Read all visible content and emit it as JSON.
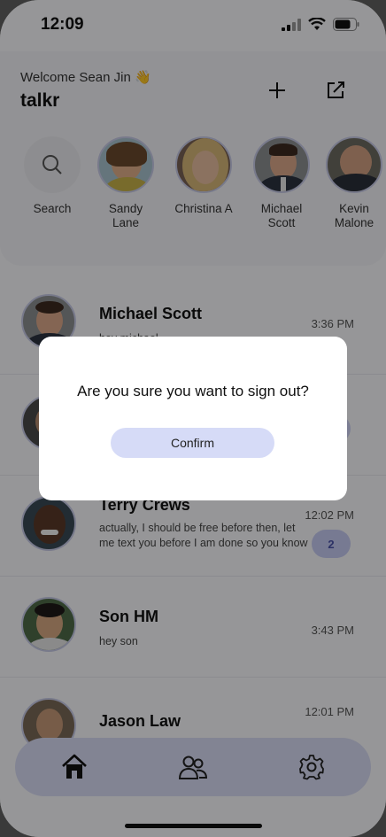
{
  "status_bar": {
    "time": "12:09"
  },
  "header": {
    "welcome": "Welcome Sean Jin 👋",
    "app_title": "talkr"
  },
  "stories": [
    {
      "name": "Search",
      "icon": "search-icon"
    },
    {
      "name": "Sandy\nLane"
    },
    {
      "name": "Christina A"
    },
    {
      "name": "Michael\nScott"
    },
    {
      "name": "Kevin\nMalone"
    }
  ],
  "chats": [
    {
      "name": "Michael Scott",
      "message": "hey michael",
      "time": "3:36 PM"
    },
    {
      "name": "",
      "message": "",
      "time": "",
      "unread": ""
    },
    {
      "name": "Terry Crews",
      "message": "actually, I should be free before then, let me text you before I am done so you know",
      "time": "12:02 PM",
      "unread": "2"
    },
    {
      "name": "Son HM",
      "message": "hey son",
      "time": "3:43 PM"
    },
    {
      "name": "Jason Law",
      "message": "",
      "time": "12:01 PM"
    }
  ],
  "tab_bar": {
    "items": [
      {
        "icon": "home-icon"
      },
      {
        "icon": "people-icon"
      },
      {
        "icon": "gear-icon"
      }
    ]
  },
  "modal": {
    "message": "Are you sure you want to sign out?",
    "confirm_label": "Confirm"
  },
  "colors": {
    "accent": "#d6dbf7",
    "tab_bar": "#d9dcf6",
    "unread_badge": "#c7cbf3"
  }
}
